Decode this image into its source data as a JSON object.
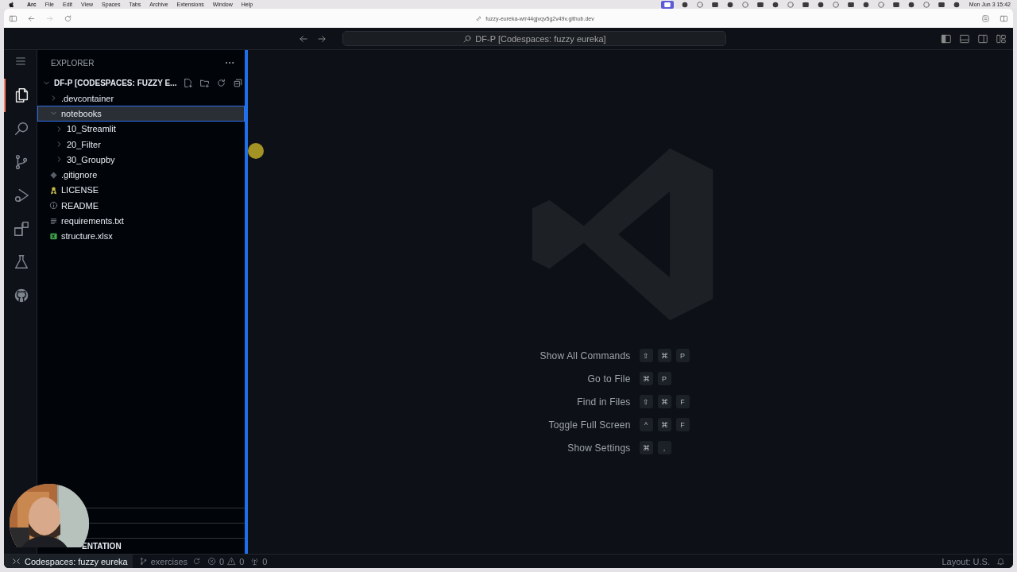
{
  "menu_bar": {
    "app": "Arc",
    "menus": [
      "File",
      "Edit",
      "View",
      "Spaces",
      "Tabs",
      "Archive",
      "Extensions",
      "Window",
      "Help"
    ],
    "clock": "Mon Jun 3  15:42"
  },
  "browser": {
    "url": "fuzzy-eureka-wrr44gjvqv5g2v49v.github.dev"
  },
  "title_bar": {
    "search": "DF-P [Codespaces: fuzzy eureka]"
  },
  "activity_bar": [
    {
      "kind": "files",
      "selected": true
    },
    {
      "kind": "search",
      "selected": false
    },
    {
      "kind": "branch",
      "selected": false
    },
    {
      "kind": "debug",
      "selected": false
    },
    {
      "kind": "extensions",
      "selected": false
    },
    {
      "kind": "flask",
      "selected": false
    },
    {
      "kind": "github",
      "selected": false
    }
  ],
  "explorer": {
    "title": "EXPLORER",
    "root": {
      "label": "DF-P [CODESPACES: FUZZY E...",
      "expanded": true
    },
    "tree": [
      {
        "label": ".devcontainer",
        "kind": "folder",
        "expanded": false,
        "selected": false
      },
      {
        "label": "notebooks",
        "kind": "folder",
        "expanded": true,
        "selected": true,
        "children": [
          {
            "label": "10_Streamlit",
            "kind": "folder",
            "expanded": false,
            "selected": false
          },
          {
            "label": "20_Filter",
            "kind": "folder",
            "expanded": false,
            "selected": false
          },
          {
            "label": "30_Groupby",
            "kind": "folder",
            "expanded": false,
            "selected": false
          }
        ]
      },
      {
        "label": ".gitignore",
        "kind": "git",
        "selected": false
      },
      {
        "label": "LICENSE",
        "kind": "license",
        "selected": false
      },
      {
        "label": "README",
        "kind": "info",
        "selected": false
      },
      {
        "label": "requirements.txt",
        "kind": "text",
        "selected": false
      },
      {
        "label": "structure.xlsx",
        "kind": "excel",
        "selected": false
      }
    ],
    "panel_header": "ENTATION"
  },
  "shortcuts": [
    {
      "label": "Show All Commands",
      "keys": [
        "⇧",
        "⌘",
        "P"
      ]
    },
    {
      "label": "Go to File",
      "keys": [
        "⌘",
        "P"
      ]
    },
    {
      "label": "Find in Files",
      "keys": [
        "⇧",
        "⌘",
        "F"
      ]
    },
    {
      "label": "Toggle Full Screen",
      "keys": [
        "^",
        "⌘",
        "F"
      ]
    },
    {
      "label": "Show Settings",
      "keys": [
        "⌘",
        ","
      ]
    }
  ],
  "status_bar": {
    "remote": "Codespaces: fuzzy eureka",
    "branch": "exercises",
    "errors": "0",
    "warnings": "0",
    "ports": "0",
    "layout": "Layout: U.S."
  }
}
